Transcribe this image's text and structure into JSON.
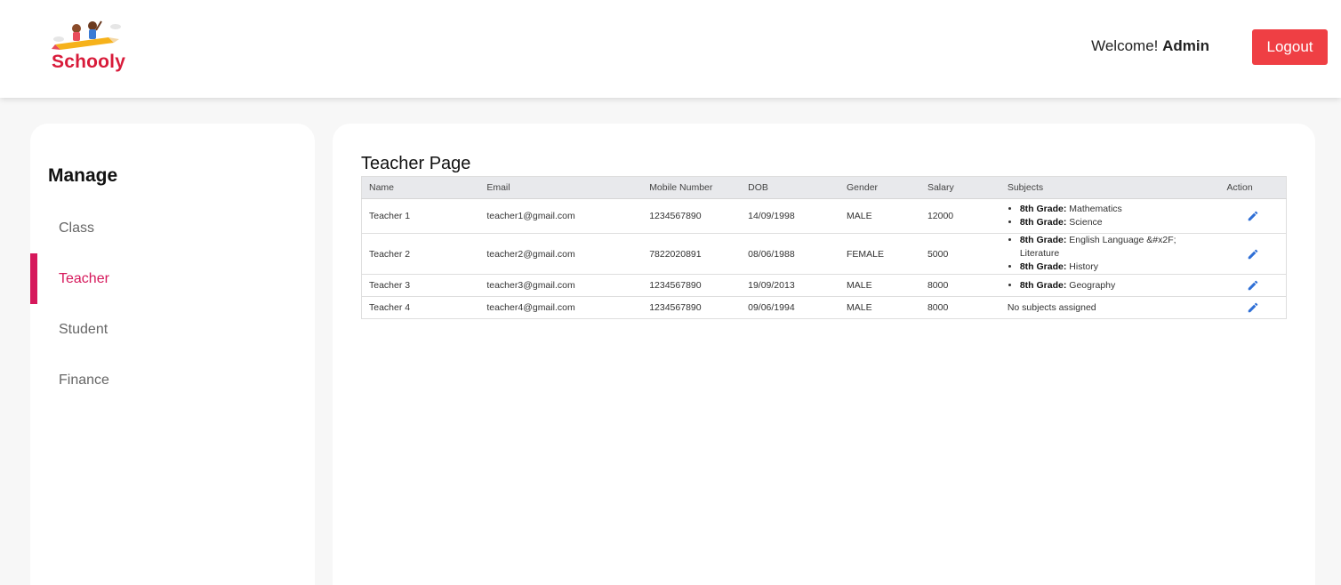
{
  "header": {
    "logo_text": "Schooly",
    "welcome_prefix": "Welcome!",
    "user_name": "Admin",
    "logout_label": "Logout"
  },
  "sidebar": {
    "title": "Manage",
    "items": [
      {
        "label": "Class",
        "active": false
      },
      {
        "label": "Teacher",
        "active": true
      },
      {
        "label": "Student",
        "active": false
      },
      {
        "label": "Finance",
        "active": false
      }
    ]
  },
  "main": {
    "title": "Teacher Page",
    "columns": [
      "Name",
      "Email",
      "Mobile Number",
      "DOB",
      "Gender",
      "Salary",
      "Subjects",
      "Action"
    ],
    "rows": [
      {
        "name": "Teacher 1",
        "email": "teacher1@gmail.com",
        "mobile": "1234567890",
        "dob": "14/09/1998",
        "gender": "MALE",
        "salary": "12000",
        "subjects": [
          {
            "grade": "8th Grade:",
            "subject": "Mathematics"
          },
          {
            "grade": "8th Grade:",
            "subject": "Science"
          }
        ],
        "no_subjects": ""
      },
      {
        "name": "Teacher 2",
        "email": "teacher2@gmail.com",
        "mobile": "7822020891",
        "dob": "08/06/1988",
        "gender": "FEMALE",
        "salary": "5000",
        "subjects": [
          {
            "grade": "8th Grade:",
            "subject": "English Language &#x2F; Literature"
          },
          {
            "grade": "8th Grade:",
            "subject": "History"
          }
        ],
        "no_subjects": ""
      },
      {
        "name": "Teacher 3",
        "email": "teacher3@gmail.com",
        "mobile": "1234567890",
        "dob": "19/09/2013",
        "gender": "MALE",
        "salary": "8000",
        "subjects": [
          {
            "grade": "8th Grade:",
            "subject": "Geography"
          }
        ],
        "no_subjects": ""
      },
      {
        "name": "Teacher 4",
        "email": "teacher4@gmail.com",
        "mobile": "1234567890",
        "dob": "09/06/1994",
        "gender": "MALE",
        "salary": "8000",
        "subjects": [],
        "no_subjects": "No subjects assigned"
      }
    ]
  },
  "colors": {
    "accent": "#d6185b",
    "logout": "#ef3f44",
    "edit_icon": "#2f6fd6",
    "logo_red": "#d81b3a"
  }
}
